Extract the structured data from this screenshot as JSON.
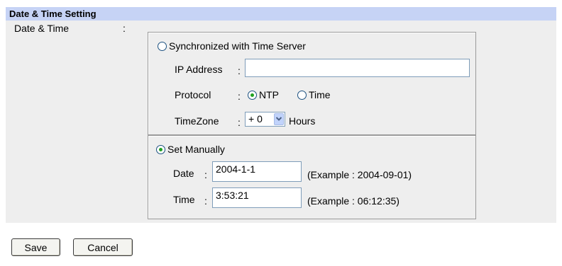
{
  "section": {
    "title": "Date & Time Setting"
  },
  "row": {
    "label": "Date & Time",
    "separator": ":"
  },
  "sync": {
    "label": "Synchronized with Time Server",
    "selected": false,
    "ip_label": "IP Address",
    "ip_value": "",
    "protocol_label": "Protocol",
    "protocol_options": [
      "NTP",
      "Time"
    ],
    "protocol_selected": "NTP",
    "timezone_label": "TimeZone",
    "timezone_value": "+ 0",
    "timezone_unit": "Hours",
    "sep": ":"
  },
  "manual": {
    "label": "Set Manually",
    "selected": true,
    "date_label": "Date",
    "date_value": "2004-1-1",
    "date_example": "(Example : 2004-09-01)",
    "time_label": "Time",
    "time_value": "3:53:21",
    "time_example": "(Example : 06:12:35)",
    "sep": ":"
  },
  "buttons": {
    "save": "Save",
    "cancel": "Cancel"
  }
}
